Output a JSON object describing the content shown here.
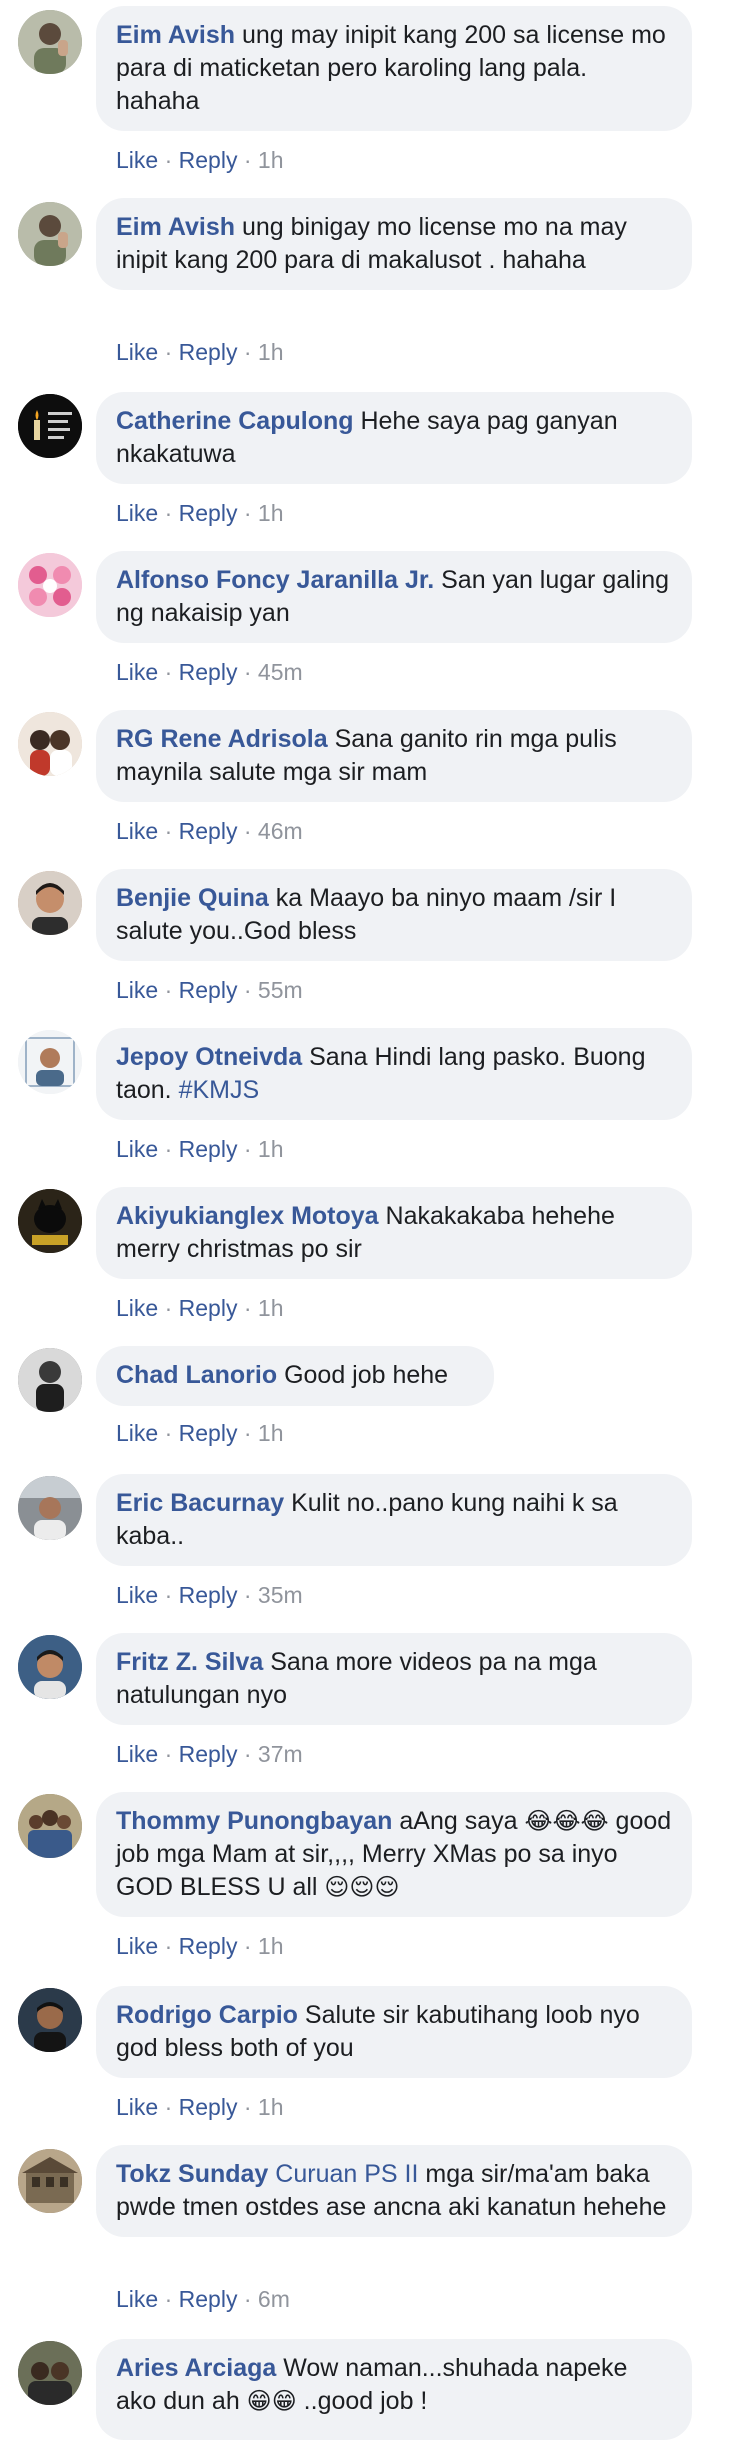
{
  "labels": {
    "like": "Like",
    "reply": "Reply",
    "dot": " · "
  },
  "colors": {
    "link": "#385898",
    "meta": "#90949c",
    "bubble": "#f0f2f5"
  },
  "comments": [
    {
      "author": "Eim Avish",
      "text": "ung may inipit kang 200 sa license mo para di maticketan pero karoling lang pala. hahaha",
      "time": "1h",
      "avatar_icon": "man-with-hand-photo"
    },
    {
      "author": "Eim Avish",
      "text": "ung binigay mo license mo na may inipit kang 200 para di makalusot . hahaha",
      "time": "1h",
      "avatar_icon": "man-with-hand-photo"
    },
    {
      "author": "Catherine Capulong",
      "text": "Hehe saya pag ganyan nkakatuwa",
      "time": "1h",
      "avatar_icon": "candle-memorial-photo"
    },
    {
      "author": "Alfonso Foncy Jaranilla Jr.",
      "text": "San yan lugar galing ng nakaisip yan",
      "time": "45m",
      "avatar_icon": "pink-collage-photo"
    },
    {
      "author": "RG Rene Adrisola",
      "text": "Sana ganito rin mga pulis maynila salute mga sir mam",
      "time": "46m",
      "avatar_icon": "couple-photo"
    },
    {
      "author": "Benjie Quina",
      "text": "ka Maayo ba ninyo maam /sir I salute you..God bless",
      "time": "55m",
      "avatar_icon": "young-man-photo"
    },
    {
      "author": "Jepoy Otneivda",
      "text": "Sana Hindi lang pasko. Buong taon.",
      "tag": "#KMJS",
      "time": "1h",
      "avatar_icon": "man-portrait-photo"
    },
    {
      "author": "Akiyukianglex Motoya",
      "text": "Nakakakaba hehehe merry christmas po sir",
      "time": "1h",
      "avatar_icon": "black-cat-2018-photo"
    },
    {
      "author": "Chad Lanorio",
      "text": "Good job hehe",
      "time": "1h",
      "avatar_icon": "man-dark-photo"
    },
    {
      "author": "Eric Bacurnay",
      "text": "Kulit no..pano kung naihi k sa kaba..",
      "time": "35m",
      "avatar_icon": "man-in-car-photo"
    },
    {
      "author": "Fritz Z. Silva",
      "text": "Sana more videos pa na mga natulungan nyo",
      "time": "37m",
      "avatar_icon": "man-selfie-photo"
    },
    {
      "author": "Thommy Punongbayan",
      "text": "aAng saya",
      "emoji1": "😂😂😂",
      "text2": "good job mga Mam at sir,,,, Merry XMas po sa inyo GOD BLESS U all",
      "emoji2": "😌😌😌",
      "time": "1h",
      "avatar_icon": "family-photo"
    },
    {
      "author": "Rodrigo Carpio",
      "text": "Salute sir kabutihang loob nyo god bless both of you",
      "time": "1h",
      "avatar_icon": "man-face-photo"
    },
    {
      "author": "Tokz Sunday",
      "tag": "Curuan PS II",
      "text": "mga sir/ma'am baka pwde tmen ostdes ase ancna aki kanatun hehehe",
      "time": "6m",
      "avatar_icon": "building-photo"
    },
    {
      "author": "Aries Arciaga",
      "text": "Wow naman...shuhada napeke ako dun ah",
      "emoji1": "😁😁",
      "text2": "..good job !",
      "time": "",
      "avatar_icon": "group-photo"
    }
  ]
}
